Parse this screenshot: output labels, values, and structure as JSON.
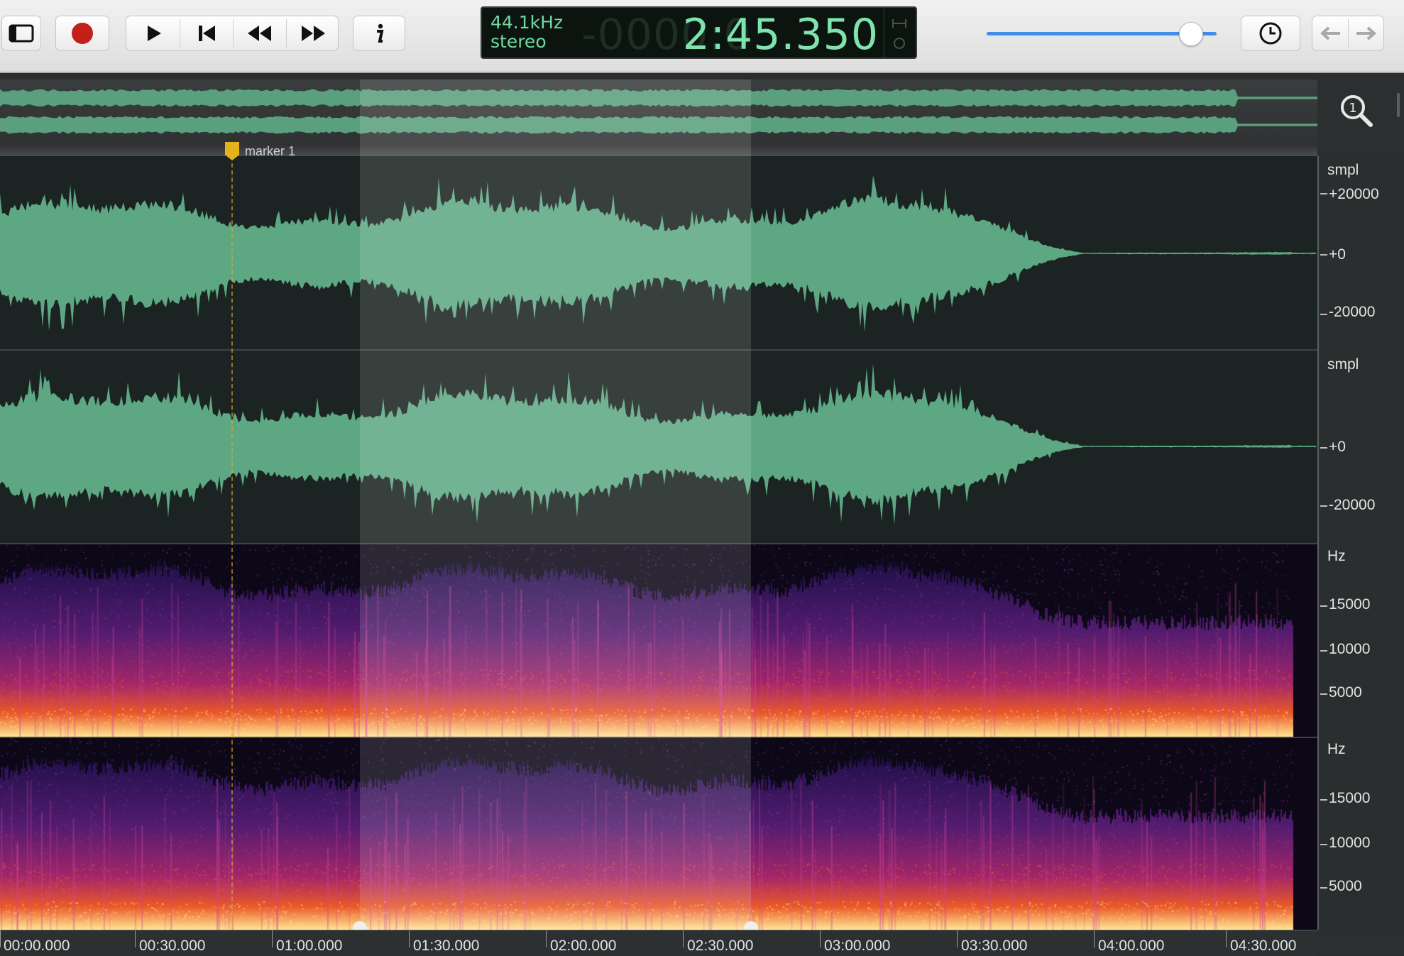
{
  "toolbar": {
    "lcd": {
      "sample_rate": "44.1kHz",
      "channels": "stereo",
      "ghost_digits": "-0000:0",
      "time": "2:45.350"
    },
    "volume_level": 0.89
  },
  "overview": {
    "marker_label": "marker 1"
  },
  "tracks": {
    "wave_left": {
      "unit": "smpl",
      "ticks": [
        "+20000",
        "+0",
        "-20000"
      ]
    },
    "wave_right": {
      "unit": "smpl",
      "ticks": [
        "+0",
        "-20000"
      ]
    },
    "spec_left": {
      "unit": "Hz",
      "ticks": [
        "15000",
        "10000",
        "5000"
      ]
    },
    "spec_right": {
      "unit": "Hz",
      "ticks": [
        "15000",
        "10000",
        "5000"
      ]
    }
  },
  "timeline": {
    "labels": [
      "00:00.000",
      "00:30.000",
      "01:00.000",
      "01:30.000",
      "02:00.000",
      "02:30.000",
      "03:00.000",
      "03:30.000",
      "04:00.000",
      "04:30.000"
    ]
  },
  "colors": {
    "wave": "#5da883",
    "wave_bg": "#1b2422",
    "lcd_text": "#7fe3ae",
    "accent": "#3d8fe8",
    "marker": "#e3b31e",
    "record": "#c22018"
  },
  "icons": {
    "sidebar": "sidebar-toggle-icon",
    "record": "record-icon",
    "play": "play-icon",
    "to_start": "skip-to-start-icon",
    "rewind": "rewind-icon",
    "fast_forward": "fast-forward-icon",
    "info": "info-icon",
    "history": "clock-icon",
    "back": "arrow-left-icon",
    "forward": "arrow-right-icon",
    "zoom": "zoom-1-to-1-icon"
  }
}
